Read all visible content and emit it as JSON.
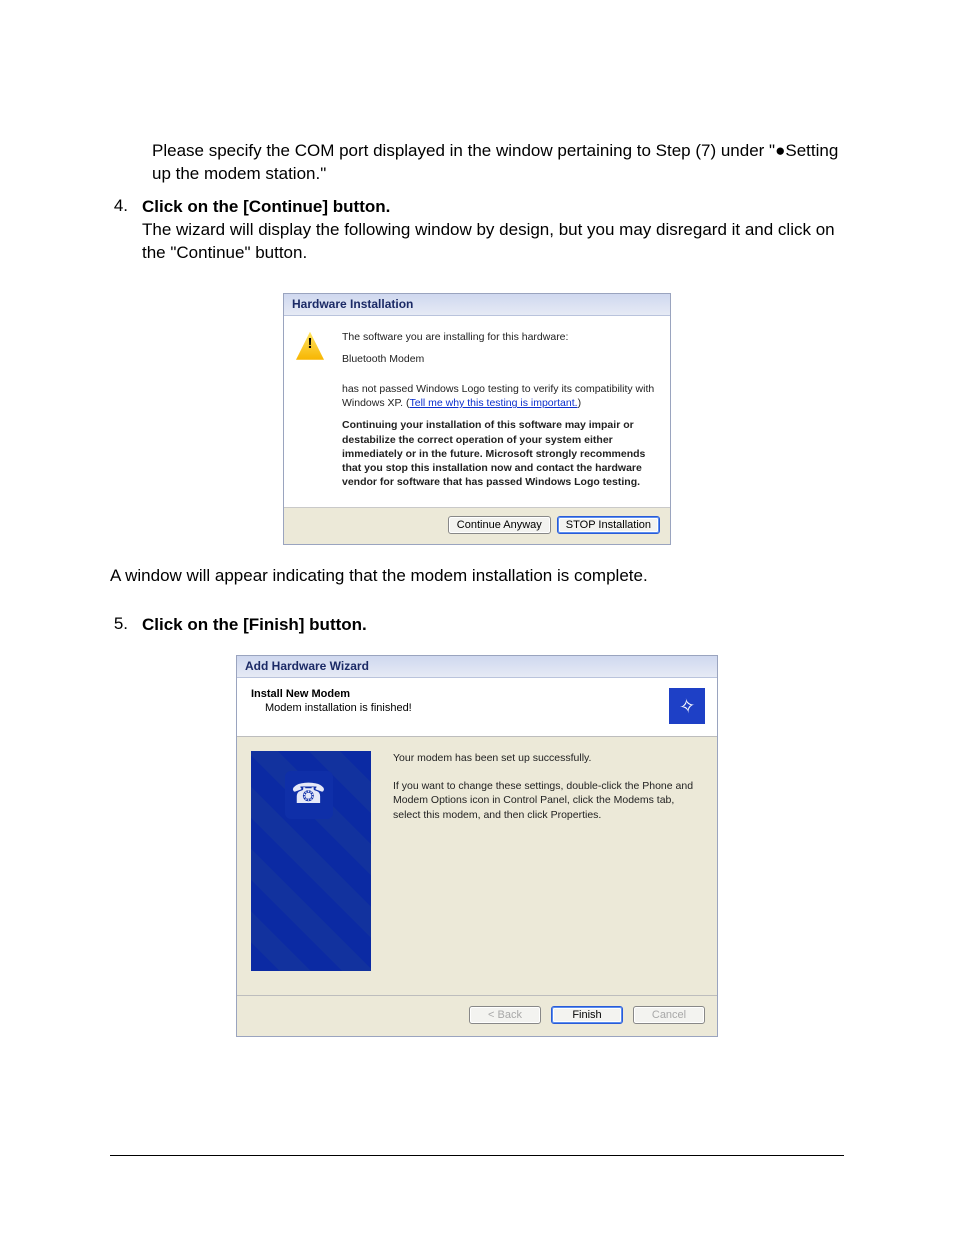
{
  "intro": "Please specify the COM port displayed in the window pertaining to Step (7) under \"●Setting up the modem station.\"",
  "step4": {
    "num": "4.",
    "heading": "Click on the [Continue] button.",
    "body": "The wizard will display the following window by design, but you may disregard it and click on the \"Continue\" button."
  },
  "dlg1": {
    "title": "Hardware Installation",
    "line1": "The software you are installing for this hardware:",
    "line2": "Bluetooth Modem",
    "line3a": "has not passed Windows Logo testing to verify its compatibility with Windows XP. (",
    "link": "Tell me why this testing is important.",
    "line3b": ")",
    "bold": "Continuing your installation of this software may impair or destabilize the correct operation of your system either immediately or in the future. Microsoft strongly recommends that you stop this installation now and contact the hardware vendor for software that has passed Windows Logo testing.",
    "btn_continue": "Continue Anyway",
    "btn_stop": "STOP Installation"
  },
  "post4": "A window will appear indicating that the modem installation is complete.",
  "step5": {
    "num": "5.",
    "heading": "Click on the [Finish] button."
  },
  "dlg2": {
    "title": "Add Hardware Wizard",
    "hdr_bold": "Install New Modem",
    "hdr_sub": "Modem installation is finished!",
    "body1": "Your modem has been set up successfully.",
    "body2": "If you want to change these settings, double-click the Phone and Modem Options icon in Control Panel, click the Modems tab, select this modem, and then click Properties.",
    "btn_back": "< Back",
    "btn_finish": "Finish",
    "btn_cancel": "Cancel"
  }
}
